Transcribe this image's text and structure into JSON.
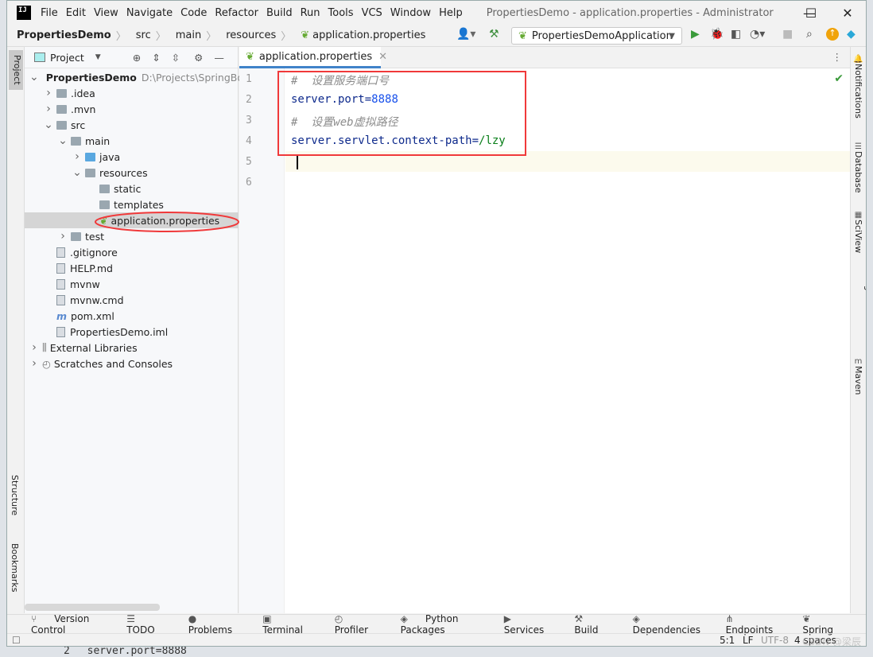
{
  "window": {
    "title": "PropertiesDemo - application.properties - Administrator",
    "logo": "IJ",
    "minimize": "—",
    "maximize": "☐",
    "close": "✕"
  },
  "menu": [
    "File",
    "Edit",
    "View",
    "Navigate",
    "Code",
    "Refactor",
    "Build",
    "Run",
    "Tools",
    "VCS",
    "Window",
    "Help"
  ],
  "breadcrumb": [
    "PropertiesDemo",
    "src",
    "main",
    "resources",
    "application.properties"
  ],
  "toolbar": {
    "run_config": "PropertiesDemoApplication"
  },
  "project": {
    "header": "Project",
    "tree": [
      {
        "label": "PropertiesDemo",
        "path": "D:\\Projects\\SpringBo",
        "depth": 0,
        "arrow": "open",
        "type": "module"
      },
      {
        "label": ".idea",
        "depth": 1,
        "arrow": "closed",
        "type": "folder"
      },
      {
        "label": ".mvn",
        "depth": 1,
        "arrow": "closed",
        "type": "folder"
      },
      {
        "label": "src",
        "depth": 1,
        "arrow": "open",
        "type": "folder"
      },
      {
        "label": "main",
        "depth": 2,
        "arrow": "open",
        "type": "folder"
      },
      {
        "label": "java",
        "depth": 3,
        "arrow": "closed",
        "type": "blue"
      },
      {
        "label": "resources",
        "depth": 3,
        "arrow": "open",
        "type": "folder"
      },
      {
        "label": "static",
        "depth": 4,
        "arrow": "",
        "type": "folder"
      },
      {
        "label": "templates",
        "depth": 4,
        "arrow": "",
        "type": "folder"
      },
      {
        "label": "application.properties",
        "depth": 4,
        "arrow": "",
        "type": "spring",
        "selected": true
      },
      {
        "label": "test",
        "depth": 2,
        "arrow": "closed",
        "type": "folder"
      },
      {
        "label": ".gitignore",
        "depth": 1,
        "arrow": "",
        "type": "file"
      },
      {
        "label": "HELP.md",
        "depth": 1,
        "arrow": "",
        "type": "file"
      },
      {
        "label": "mvnw",
        "depth": 1,
        "arrow": "",
        "type": "file"
      },
      {
        "label": "mvnw.cmd",
        "depth": 1,
        "arrow": "",
        "type": "file"
      },
      {
        "label": "pom.xml",
        "depth": 1,
        "arrow": "",
        "type": "maven"
      },
      {
        "label": "PropertiesDemo.iml",
        "depth": 1,
        "arrow": "",
        "type": "file"
      },
      {
        "label": "External Libraries",
        "depth": 0,
        "arrow": "closed",
        "type": "lib"
      },
      {
        "label": "Scratches and Consoles",
        "depth": 0,
        "arrow": "closed",
        "type": "scratch"
      }
    ]
  },
  "left_stripe": {
    "top": "Project",
    "structure": "Structure",
    "bookmarks": "Bookmarks"
  },
  "editor": {
    "tab": "application.properties",
    "line_numbers": [
      "1",
      "2",
      "3",
      "4",
      "5",
      "6"
    ],
    "lines": [
      {
        "comment": "#  设置服务端口号"
      },
      {
        "key": "server.port",
        "eq": "=",
        "value": "8888",
        "kind": "num"
      },
      {
        "comment": "#  设置web虚拟路径"
      },
      {
        "key": "server.servlet.context-path",
        "eq": "=",
        "value": "/lzy",
        "kind": "val"
      },
      {},
      {}
    ],
    "cursor_line": 5
  },
  "right_stripe": [
    "Notifications",
    "Database",
    "SciView",
    "Big Data Tools",
    "Maven"
  ],
  "bottom_tools": [
    "Version Control",
    "TODO",
    "Problems",
    "Terminal",
    "Profiler",
    "Python Packages",
    "Services",
    "Build",
    "Dependencies",
    "Endpoints",
    "Spring"
  ],
  "status": {
    "position": "5:1",
    "line_sep": "LF",
    "encoding": "UTF-8",
    "indent": "4 spaces",
    "watermark": "CSDN @梁辰兴"
  },
  "background_text": {
    "line_no": "2",
    "code": "server.port=8888"
  },
  "colors": {
    "highlight_box": "#f0393a",
    "keyword": "#0e2a8c",
    "number": "#1750eb",
    "string": "#067d17",
    "comment": "#8c8c8c",
    "accent": "#4083c9"
  }
}
